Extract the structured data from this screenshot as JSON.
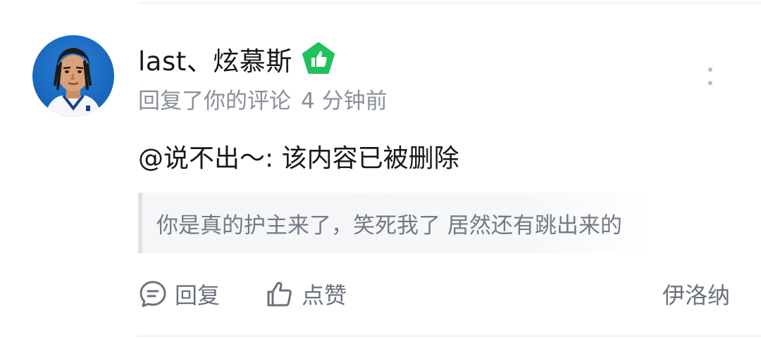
{
  "notification": {
    "user": {
      "name": "last、炫慕斯",
      "avatar": "player-avatar",
      "badge_icon": "thumbs-up-badge-icon",
      "badge_color": "#1fc25a"
    },
    "meta": {
      "action_text": "回复了你的评论",
      "time": "4 分钟前"
    },
    "more_icon": "more-vertical-icon",
    "content": "@说不出～: 该内容已被删除",
    "quote": "你是真的护主来了，笑死我了 居然还有跳出来的",
    "actions": {
      "reply_label": "回复",
      "reply_icon": "comment-bubble-icon",
      "like_label": "点赞",
      "like_icon": "thumbs-up-icon",
      "source_user": "伊洛纳"
    }
  },
  "colors": {
    "primary_text": "#17181a",
    "secondary_text": "#8a8f99",
    "quote_bg": "#f5f6f8",
    "quote_border": "#dfe1e6",
    "badge_green": "#1fc25a"
  }
}
